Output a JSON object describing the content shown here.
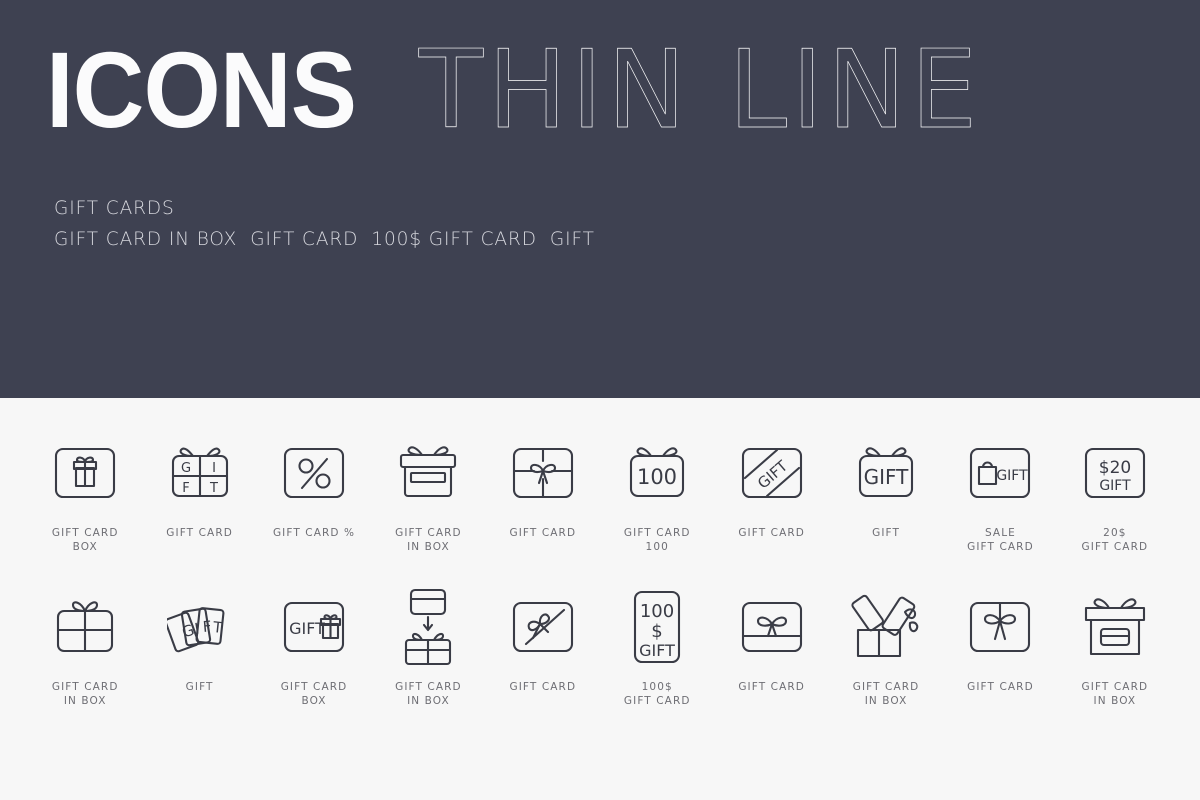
{
  "hero": {
    "title_bold": "ICONS",
    "title_thin": "THIN LINE",
    "subtitle_line1": "GIFT CARDS",
    "subtitle_line2_segments": [
      "GIFT CARD IN BOX",
      "GIFT CARD",
      "100$ GIFT CARD",
      "GIFT"
    ],
    "background_color": "#3E4151",
    "title_color": "#FBFBFC",
    "subtitle_color": "#D7D8DE"
  },
  "page": {
    "background_color": "#F7F7F7",
    "icon_stroke_color": "#3A3C46",
    "caption_color": "#6E6E74"
  },
  "rows": [
    {
      "cells": [
        {
          "icon": "gift-card-box-icon",
          "caption": "GIFT CARD\nBOX",
          "glyph": ""
        },
        {
          "icon": "gift-box-letters-icon",
          "caption": "GIFT CARD",
          "glyph": "GIFT"
        },
        {
          "icon": "gift-card-percent-icon",
          "caption": "GIFT CARD %",
          "glyph": "%"
        },
        {
          "icon": "gift-card-in-box-lid-icon",
          "caption": "GIFT CARD\nIN BOX",
          "glyph": ""
        },
        {
          "icon": "gift-card-bow-icon",
          "caption": "GIFT CARD",
          "glyph": ""
        },
        {
          "icon": "gift-card-100-icon",
          "caption": "GIFT CARD\n100",
          "glyph": "100"
        },
        {
          "icon": "gift-card-ribbon-diagonal-icon",
          "caption": "GIFT CARD",
          "glyph": "GIFT"
        },
        {
          "icon": "gift-card-gift-text-icon",
          "caption": "GIFT",
          "glyph": "GIFT"
        },
        {
          "icon": "sale-gift-card-icon",
          "caption": "SALE\nGIFT CARD",
          "glyph": "GIFT"
        },
        {
          "icon": "gift-card-20-dollar-icon",
          "caption": "20$\nGIFT CARD",
          "glyph": "$20 GIFT"
        }
      ]
    },
    {
      "cells": [
        {
          "icon": "gift-box-ribbon-bow-icon",
          "caption": "GIFT CARD\nIN BOX",
          "glyph": ""
        },
        {
          "icon": "gift-cards-fan-icon",
          "caption": "GIFT",
          "glyph": "GIFT"
        },
        {
          "icon": "gift-card-box-text-icon",
          "caption": "GIFT CARD\nBOX",
          "glyph": "GIFT"
        },
        {
          "icon": "card-into-box-arrow-icon",
          "caption": "GIFT CARD\nIN BOX",
          "glyph": ""
        },
        {
          "icon": "gift-card-bow-diagonal-icon",
          "caption": "GIFT CARD",
          "glyph": ""
        },
        {
          "icon": "gift-card-100-dollar-icon",
          "caption": "100$\nGIFT CARD",
          "glyph": "100 $ GIFT"
        },
        {
          "icon": "gift-card-bow-band-icon",
          "caption": "GIFT CARD",
          "glyph": ""
        },
        {
          "icon": "open-box-cards-icon",
          "caption": "GIFT CARD\nIN BOX",
          "glyph": ""
        },
        {
          "icon": "gift-card-center-bow-icon",
          "caption": "GIFT CARD",
          "glyph": ""
        },
        {
          "icon": "gift-box-lid-card-icon",
          "caption": "GIFT CARD\nIN BOX",
          "glyph": ""
        }
      ]
    }
  ]
}
